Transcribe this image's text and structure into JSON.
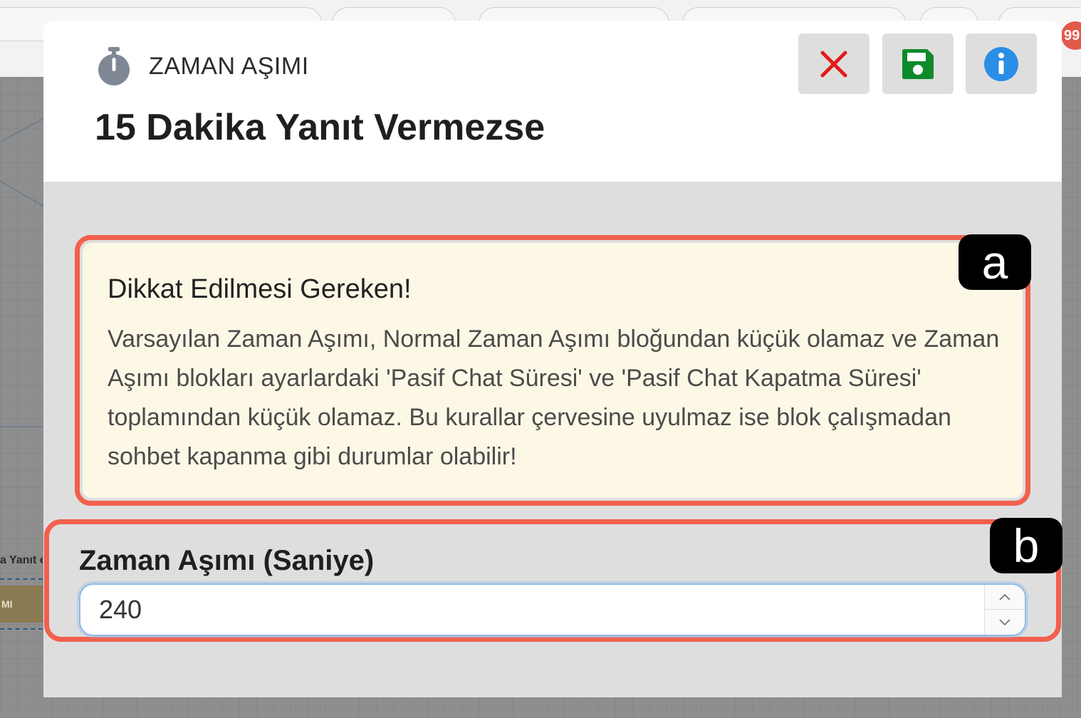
{
  "background": {
    "node_label": "a Yanıt ezse",
    "node_bar_text": "MI",
    "notification_count": "99"
  },
  "modal": {
    "block_type_label": "ZAMAN AŞIMI",
    "title": "15 Dakika Yanıt Vermezse",
    "buttons": {
      "close_icon": "close-icon",
      "save_icon": "floppy-disk-icon",
      "info_icon": "info-icon"
    },
    "colors": {
      "close": "#e31b1b",
      "save": "#0d8a2a",
      "info": "#2a8ee6",
      "annotation_outline": "#f2604d",
      "warning_bg": "#fdf8e6"
    }
  },
  "warning": {
    "title": "Dikkat Edilmesi Gereken!",
    "text": "Varsayılan Zaman Aşımı, Normal Zaman Aşımı bloğundan küçük olamaz ve Zaman Aşımı blokları ayarlardaki 'Pasif Chat Süresi' ve 'Pasif Chat Kapatma Süresi' toplamından küçük olamaz. Bu kurallar çervesine uyulmaz ise blok çalışmadan sohbet kapanma gibi durumlar olabilir!"
  },
  "timeout_field": {
    "label": "Zaman Aşımı (Saniye)",
    "value": "240"
  },
  "annotations": {
    "a": "a",
    "b": "b"
  }
}
